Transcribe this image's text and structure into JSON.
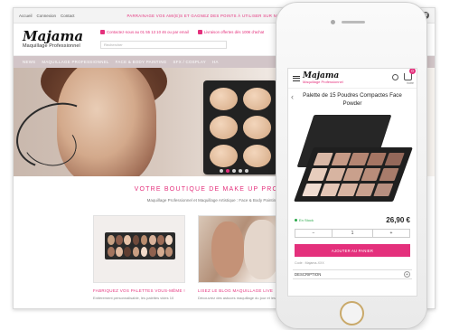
{
  "desktop": {
    "topbar": {
      "links": [
        "Accueil",
        "Connexion",
        "Contact"
      ],
      "promo": "PARRAINAGE VOS AMI(E)S ET GAGNEZ DES POINTS À UTILISER SUR NOTRE BOUTIQUE",
      "follow_label": "Suivez-nous",
      "social": [
        "f",
        "W"
      ]
    },
    "header": {
      "logo_name": "Majama",
      "logo_tagline": "Maquillage Professionnel",
      "contact_info": "Contactez-nous au 01 55 13 10 46 ou par email",
      "delivery_info": "Livraison offertes dès 100€ d'achat",
      "search_placeholder": "Rechercher"
    },
    "nav": [
      "NEWS",
      "MAQUILLAGE PROFESSIONNEL",
      "FACE & BODY PAINTING",
      "SFX / COSPLAY",
      "HA"
    ],
    "welcome": {
      "title": "VOTRE BOUTIQUE DE MAKE UP PROFESSION",
      "subtitle": "Maquillage Professionnel et Maquillage Artistique : Face & Body Painting, Make Up pr"
    },
    "cards": [
      {
        "title": "FABRIQUEZ VOS PALETTES VOUS-MÊME !",
        "desc": "Entièrement personnalisable, les palettes vides 10"
      },
      {
        "title": "LISEZ LE BLOG MAQUILLAGE LIVE",
        "desc": "Découvrez des astuces maquillage du jour et les nouv"
      }
    ]
  },
  "mobile": {
    "logo_name": "Majama",
    "logo_tagline": "Maquillage Professionnel",
    "cart_count": "0",
    "cart_label": "Votre",
    "back_icon": "chevron-left-icon",
    "product_title": "Palette de 15 Poudres Compactes Face Powder",
    "stock": "En Stock",
    "price": "26,90 €",
    "qty_minus": "−",
    "qty_value": "1",
    "qty_plus": "+",
    "add_to_cart": "AJOUTER AU PANIER",
    "note": "Code : Majama-XXX",
    "description_label": "DESCRIPTION",
    "description_toggle": "+"
  },
  "colors": {
    "accent": "#e4307c",
    "nav_bg": "#d2c5c8",
    "in_stock": "#2aa84a"
  }
}
